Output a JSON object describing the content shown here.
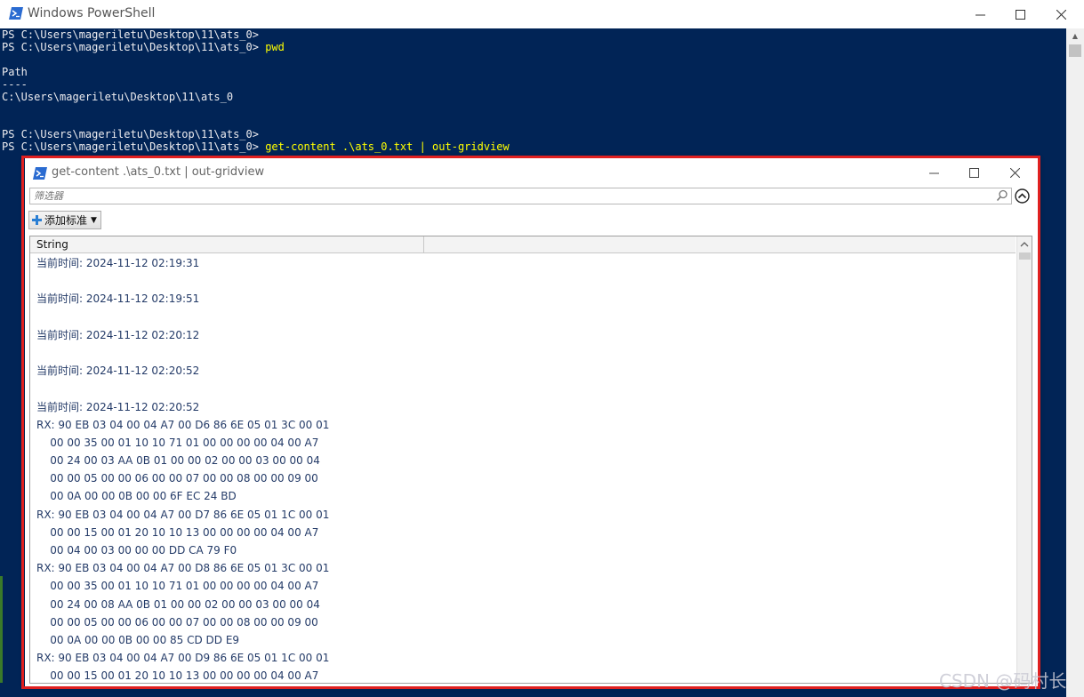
{
  "powershell": {
    "title": "Windows PowerShell",
    "lines": [
      {
        "prompt": "PS C:\\Users\\mageriletu\\Desktop\\11\\ats_0>",
        "cmd": ""
      },
      {
        "prompt": "PS C:\\Users\\mageriletu\\Desktop\\11\\ats_0>",
        "cmd": " pwd"
      },
      {
        "prompt": "",
        "cmd": ""
      },
      {
        "prompt": "Path",
        "cmd": ""
      },
      {
        "prompt": "----",
        "cmd": ""
      },
      {
        "prompt": "C:\\Users\\mageriletu\\Desktop\\11\\ats_0",
        "cmd": ""
      },
      {
        "prompt": "",
        "cmd": ""
      },
      {
        "prompt": "",
        "cmd": ""
      },
      {
        "prompt": "PS C:\\Users\\mageriletu\\Desktop\\11\\ats_0>",
        "cmd": ""
      },
      {
        "prompt": "PS C:\\Users\\mageriletu\\Desktop\\11\\ats_0>",
        "cmd": " get-content .\\ats_0.txt | out-gridview"
      }
    ]
  },
  "gridview": {
    "title": "get-content .\\ats_0.txt | out-gridview",
    "filter_placeholder": "筛选器",
    "add_criteria_label": "添加标准",
    "column_header": "String",
    "rows": [
      "当前时间: 2024-11-12 02:19:31",
      "",
      "当前时间: 2024-11-12 02:19:51",
      "",
      "当前时间: 2024-11-12 02:20:12",
      "",
      "当前时间: 2024-11-12 02:20:52",
      "",
      "当前时间: 2024-11-12 02:20:52",
      "RX: 90 EB 03 04 00 04 A7 00 D6 86 6E 05 01 3C 00 01",
      "    00 00 35 00 01 10 10 71 01 00 00 00 00 04 00 A7",
      "    00 24 00 03 AA 0B 01 00 00 02 00 00 03 00 00 04",
      "    00 00 05 00 00 06 00 00 07 00 00 08 00 00 09 00",
      "    00 0A 00 00 0B 00 00 6F EC 24 BD",
      "RX: 90 EB 03 04 00 04 A7 00 D7 86 6E 05 01 1C 00 01",
      "    00 00 15 00 01 20 10 10 13 00 00 00 00 04 00 A7",
      "    00 04 00 03 00 00 00 DD CA 79 F0",
      "RX: 90 EB 03 04 00 04 A7 00 D8 86 6E 05 01 3C 00 01",
      "    00 00 35 00 01 10 10 71 01 00 00 00 00 04 00 A7",
      "    00 24 00 08 AA 0B 01 00 00 02 00 00 03 00 00 04",
      "    00 00 05 00 00 06 00 00 07 00 00 08 00 00 09 00",
      "    00 0A 00 00 0B 00 00 85 CD DD E9",
      "RX: 90 EB 03 04 00 04 A7 00 D9 86 6E 05 01 1C 00 01",
      "    00 00 15 00 01 20 10 10 13 00 00 00 00 04 00 A7"
    ]
  },
  "watermark": "CSDN @码村长",
  "colors": {
    "console_bg": "#012456",
    "command": "#ffff00",
    "highlight_border": "#e02020",
    "row_text": "#243b68"
  }
}
